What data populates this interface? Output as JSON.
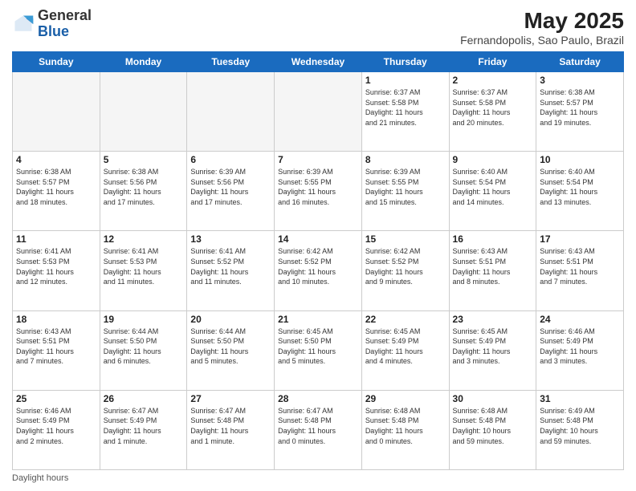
{
  "header": {
    "logo_general": "General",
    "logo_blue": "Blue",
    "month_title": "May 2025",
    "location": "Fernandopolis, Sao Paulo, Brazil"
  },
  "columns": [
    "Sunday",
    "Monday",
    "Tuesday",
    "Wednesday",
    "Thursday",
    "Friday",
    "Saturday"
  ],
  "weeks": [
    [
      {
        "day": "",
        "info": ""
      },
      {
        "day": "",
        "info": ""
      },
      {
        "day": "",
        "info": ""
      },
      {
        "day": "",
        "info": ""
      },
      {
        "day": "1",
        "info": "Sunrise: 6:37 AM\nSunset: 5:58 PM\nDaylight: 11 hours\nand 21 minutes."
      },
      {
        "day": "2",
        "info": "Sunrise: 6:37 AM\nSunset: 5:58 PM\nDaylight: 11 hours\nand 20 minutes."
      },
      {
        "day": "3",
        "info": "Sunrise: 6:38 AM\nSunset: 5:57 PM\nDaylight: 11 hours\nand 19 minutes."
      }
    ],
    [
      {
        "day": "4",
        "info": "Sunrise: 6:38 AM\nSunset: 5:57 PM\nDaylight: 11 hours\nand 18 minutes."
      },
      {
        "day": "5",
        "info": "Sunrise: 6:38 AM\nSunset: 5:56 PM\nDaylight: 11 hours\nand 17 minutes."
      },
      {
        "day": "6",
        "info": "Sunrise: 6:39 AM\nSunset: 5:56 PM\nDaylight: 11 hours\nand 17 minutes."
      },
      {
        "day": "7",
        "info": "Sunrise: 6:39 AM\nSunset: 5:55 PM\nDaylight: 11 hours\nand 16 minutes."
      },
      {
        "day": "8",
        "info": "Sunrise: 6:39 AM\nSunset: 5:55 PM\nDaylight: 11 hours\nand 15 minutes."
      },
      {
        "day": "9",
        "info": "Sunrise: 6:40 AM\nSunset: 5:54 PM\nDaylight: 11 hours\nand 14 minutes."
      },
      {
        "day": "10",
        "info": "Sunrise: 6:40 AM\nSunset: 5:54 PM\nDaylight: 11 hours\nand 13 minutes."
      }
    ],
    [
      {
        "day": "11",
        "info": "Sunrise: 6:41 AM\nSunset: 5:53 PM\nDaylight: 11 hours\nand 12 minutes."
      },
      {
        "day": "12",
        "info": "Sunrise: 6:41 AM\nSunset: 5:53 PM\nDaylight: 11 hours\nand 11 minutes."
      },
      {
        "day": "13",
        "info": "Sunrise: 6:41 AM\nSunset: 5:52 PM\nDaylight: 11 hours\nand 11 minutes."
      },
      {
        "day": "14",
        "info": "Sunrise: 6:42 AM\nSunset: 5:52 PM\nDaylight: 11 hours\nand 10 minutes."
      },
      {
        "day": "15",
        "info": "Sunrise: 6:42 AM\nSunset: 5:52 PM\nDaylight: 11 hours\nand 9 minutes."
      },
      {
        "day": "16",
        "info": "Sunrise: 6:43 AM\nSunset: 5:51 PM\nDaylight: 11 hours\nand 8 minutes."
      },
      {
        "day": "17",
        "info": "Sunrise: 6:43 AM\nSunset: 5:51 PM\nDaylight: 11 hours\nand 7 minutes."
      }
    ],
    [
      {
        "day": "18",
        "info": "Sunrise: 6:43 AM\nSunset: 5:51 PM\nDaylight: 11 hours\nand 7 minutes."
      },
      {
        "day": "19",
        "info": "Sunrise: 6:44 AM\nSunset: 5:50 PM\nDaylight: 11 hours\nand 6 minutes."
      },
      {
        "day": "20",
        "info": "Sunrise: 6:44 AM\nSunset: 5:50 PM\nDaylight: 11 hours\nand 5 minutes."
      },
      {
        "day": "21",
        "info": "Sunrise: 6:45 AM\nSunset: 5:50 PM\nDaylight: 11 hours\nand 5 minutes."
      },
      {
        "day": "22",
        "info": "Sunrise: 6:45 AM\nSunset: 5:49 PM\nDaylight: 11 hours\nand 4 minutes."
      },
      {
        "day": "23",
        "info": "Sunrise: 6:45 AM\nSunset: 5:49 PM\nDaylight: 11 hours\nand 3 minutes."
      },
      {
        "day": "24",
        "info": "Sunrise: 6:46 AM\nSunset: 5:49 PM\nDaylight: 11 hours\nand 3 minutes."
      }
    ],
    [
      {
        "day": "25",
        "info": "Sunrise: 6:46 AM\nSunset: 5:49 PM\nDaylight: 11 hours\nand 2 minutes."
      },
      {
        "day": "26",
        "info": "Sunrise: 6:47 AM\nSunset: 5:49 PM\nDaylight: 11 hours\nand 1 minute."
      },
      {
        "day": "27",
        "info": "Sunrise: 6:47 AM\nSunset: 5:48 PM\nDaylight: 11 hours\nand 1 minute."
      },
      {
        "day": "28",
        "info": "Sunrise: 6:47 AM\nSunset: 5:48 PM\nDaylight: 11 hours\nand 0 minutes."
      },
      {
        "day": "29",
        "info": "Sunrise: 6:48 AM\nSunset: 5:48 PM\nDaylight: 11 hours\nand 0 minutes."
      },
      {
        "day": "30",
        "info": "Sunrise: 6:48 AM\nSunset: 5:48 PM\nDaylight: 10 hours\nand 59 minutes."
      },
      {
        "day": "31",
        "info": "Sunrise: 6:49 AM\nSunset: 5:48 PM\nDaylight: 10 hours\nand 59 minutes."
      }
    ]
  ],
  "footer": {
    "daylight_label": "Daylight hours"
  }
}
